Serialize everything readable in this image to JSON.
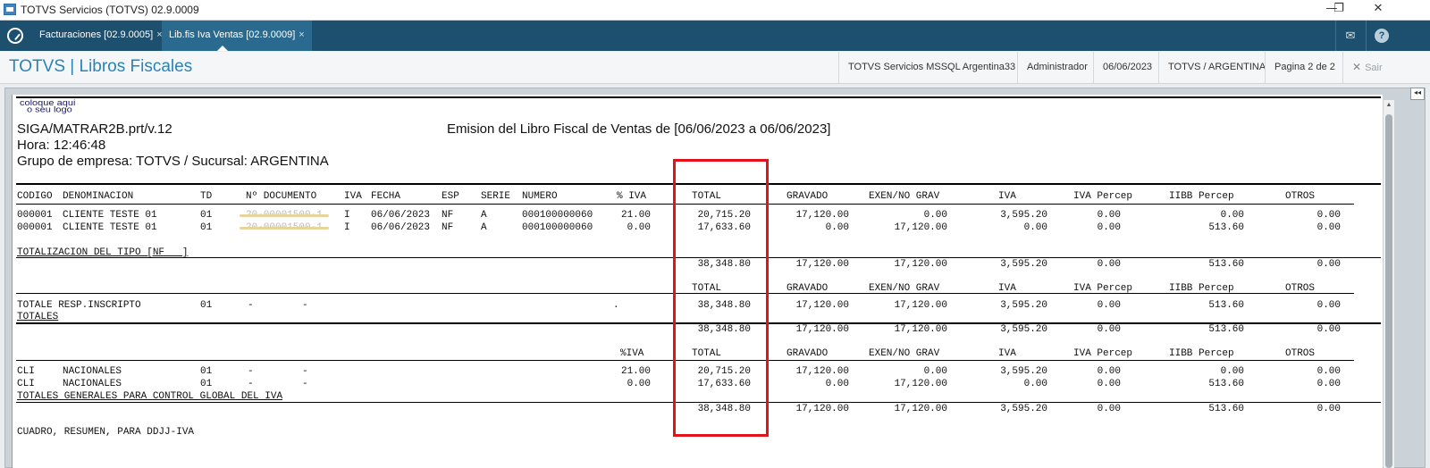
{
  "window": {
    "title": "TOTVS Servicios (TOTVS) 02.9.0009",
    "minimize": "—",
    "restore": "❐",
    "close": "✕"
  },
  "tabs": [
    {
      "label": "Facturaciones [02.9.0005]",
      "close": "×"
    },
    {
      "label": "Lib.fis Iva Ventas [02.9.0009]",
      "close": "×"
    }
  ],
  "topbar": {
    "mail_icon": "✉",
    "help_icon": "?"
  },
  "header": {
    "brand": "TOTVS | Libros Fiscales",
    "environment": "TOTVS Servicios MSSQL Argentina33",
    "user": "Administrador",
    "date": "06/06/2023",
    "company": "TOTVS / ARGENTINA",
    "page": "Pagina 2 de 2",
    "exit_icon": "✕",
    "exit": "Sair"
  },
  "report": {
    "logo_line1": "coloque aqui",
    "logo_line2": "o seu logo",
    "program": "SIGA/MATRAR2B.prt/v.12",
    "time": "Hora: 12:46:48",
    "group": "Grupo de empresa: TOTVS / Sucursal: ARGENTINA",
    "title": "Emision del Libro Fiscal de Ventas de [06/06/2023 a 06/06/2023]",
    "columns": {
      "codigo": "CODIGO",
      "denominacion": "DENOMINACION",
      "td": "TD",
      "documento": "Nº DOCUMENTO",
      "iva_col": "IVA",
      "fecha": "FECHA",
      "esp": "ESP",
      "serie": "SERIE",
      "numero": "NUMERO",
      "pct_iva": "% IVA",
      "total": "TOTAL",
      "gravado": "GRAVADO",
      "exento": "EXEN/NO GRAV",
      "iva": "IVA",
      "iva_percep": "IVA Percep",
      "iibb_percep": "IIBB Percep",
      "otros": "OTROS"
    },
    "rows": [
      {
        "codigo": "000001",
        "denom": "CLIENTE TESTE 01",
        "td": "01",
        "documento": "20-00001500-1",
        "iva_col": "I",
        "fecha": "06/06/2023",
        "esp": "NF",
        "serie": "A",
        "numero": "000100000060",
        "pct": "21.00",
        "total": "20,715.20",
        "gravado": "17,120.00",
        "exento": "0.00",
        "iva": "3,595.20",
        "iva_percep": "0.00",
        "iibb": "0.00",
        "otros": "0.00"
      },
      {
        "codigo": "000001",
        "denom": "CLIENTE TESTE 01",
        "td": "01",
        "documento": "20-00001500-1",
        "iva_col": "I",
        "fecha": "06/06/2023",
        "esp": "NF",
        "serie": "A",
        "numero": "000100000060",
        "pct": "0.00",
        "total": "17,633.60",
        "gravado": "0.00",
        "exento": "17,120.00",
        "iva": "0.00",
        "iva_percep": "0.00",
        "iibb": "513.60",
        "otros": "0.00"
      }
    ],
    "tipo_label": "TOTALIZACION DEL TIPO [NF   ]",
    "tipo_totals": {
      "total": "38,348.80",
      "gravado": "17,120.00",
      "exento": "17,120.00",
      "iva": "3,595.20",
      "iva_percep": "0.00",
      "iibb": "513.60",
      "otros": "0.00"
    },
    "resp": {
      "label": "TOTALE RESP.INSCRIPTO",
      "td": "01",
      "d1": "-",
      "d2": "-",
      "dot": ".",
      "total": "38,348.80",
      "gravado": "17,120.00",
      "exento": "17,120.00",
      "iva": "3,595.20",
      "iva_percep": "0.00",
      "iibb": "513.60",
      "otros": "0.00"
    },
    "totales_label": "TOTALES",
    "totales": {
      "total": "38,348.80",
      "gravado": "17,120.00",
      "exento": "17,120.00",
      "iva": "3,595.20",
      "iva_percep": "0.00",
      "iibb": "513.60",
      "otros": "0.00"
    },
    "pct_iva_hdr": "%IVA",
    "cli_rows": [
      {
        "cod": "CLI",
        "label": "NACIONALES",
        "td": "01",
        "d1": "-",
        "d2": "-",
        "pct": "21.00",
        "total": "20,715.20",
        "gravado": "17,120.00",
        "exento": "0.00",
        "iva": "3,595.20",
        "iva_percep": "0.00",
        "iibb": "0.00",
        "otros": "0.00"
      },
      {
        "cod": "CLI",
        "label": "NACIONALES",
        "td": "01",
        "d1": "-",
        "d2": "-",
        "pct": "0.00",
        "total": "17,633.60",
        "gravado": "0.00",
        "exento": "17,120.00",
        "iva": "0.00",
        "iva_percep": "0.00",
        "iibb": "513.60",
        "otros": "0.00"
      }
    ],
    "generales_label": "TOTALES GENERALES PARA CONTROL GLOBAL DEL IVA",
    "generales": {
      "total": "38,348.80",
      "gravado": "17,120.00",
      "exento": "17,120.00",
      "iva": "3,595.20",
      "iva_percep": "0.00",
      "iibb": "513.60",
      "otros": "0.00"
    },
    "cuadro": "CUADRO, RESUMEN, PARA DDJJ-IVA"
  },
  "highlight": {
    "color": "#e3121b"
  }
}
